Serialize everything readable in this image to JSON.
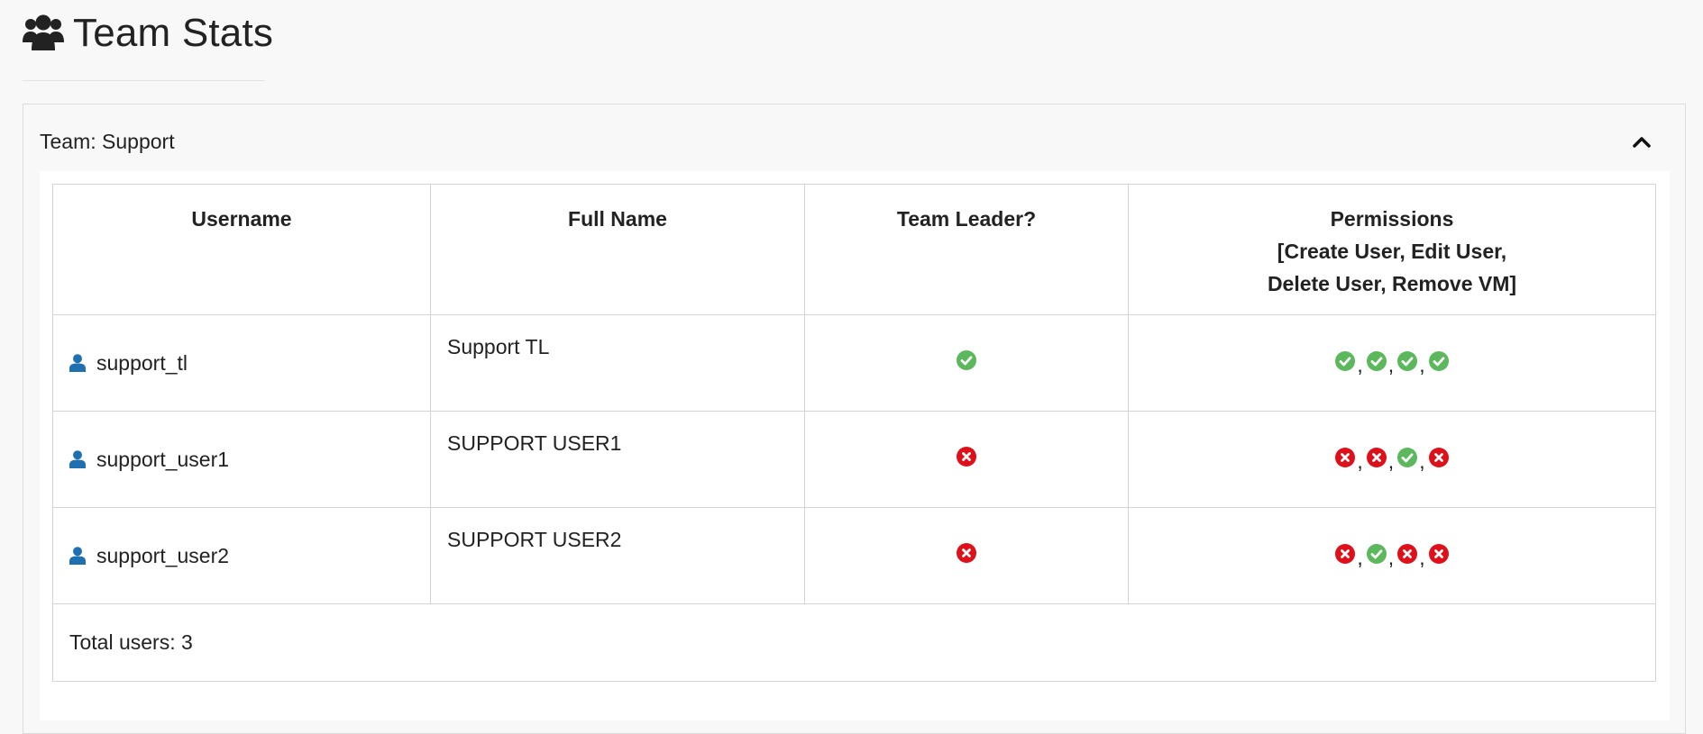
{
  "page": {
    "title": "Team Stats",
    "title_icon": "users-icon"
  },
  "panel": {
    "heading": "Team: Support",
    "toggle_icon": "chevron-up-icon"
  },
  "table": {
    "headers": {
      "username": "Username",
      "full_name": "Full Name",
      "team_leader": "Team Leader?",
      "permissions_line1": "Permissions",
      "permissions_line2": "[Create User, Edit User,",
      "permissions_line3": "Delete User, Remove VM]"
    },
    "rows": [
      {
        "username": "support_tl",
        "full_name": "Support TL",
        "team_leader": true,
        "permissions": [
          true,
          true,
          true,
          true
        ]
      },
      {
        "username": "support_user1",
        "full_name": "SUPPORT USER1",
        "team_leader": false,
        "permissions": [
          false,
          false,
          true,
          false
        ]
      },
      {
        "username": "support_user2",
        "full_name": "SUPPORT USER2",
        "team_leader": false,
        "permissions": [
          false,
          true,
          false,
          false
        ]
      }
    ],
    "separator": ",",
    "footer": "Total users: 3"
  },
  "icons": {
    "user": "user-icon",
    "yes": "check-circle-icon",
    "no": "x-circle-icon"
  },
  "colors": {
    "yes": "#5cb85c",
    "no": "#e0101b",
    "user_icon": "#1f70b0",
    "text": "#222222"
  }
}
